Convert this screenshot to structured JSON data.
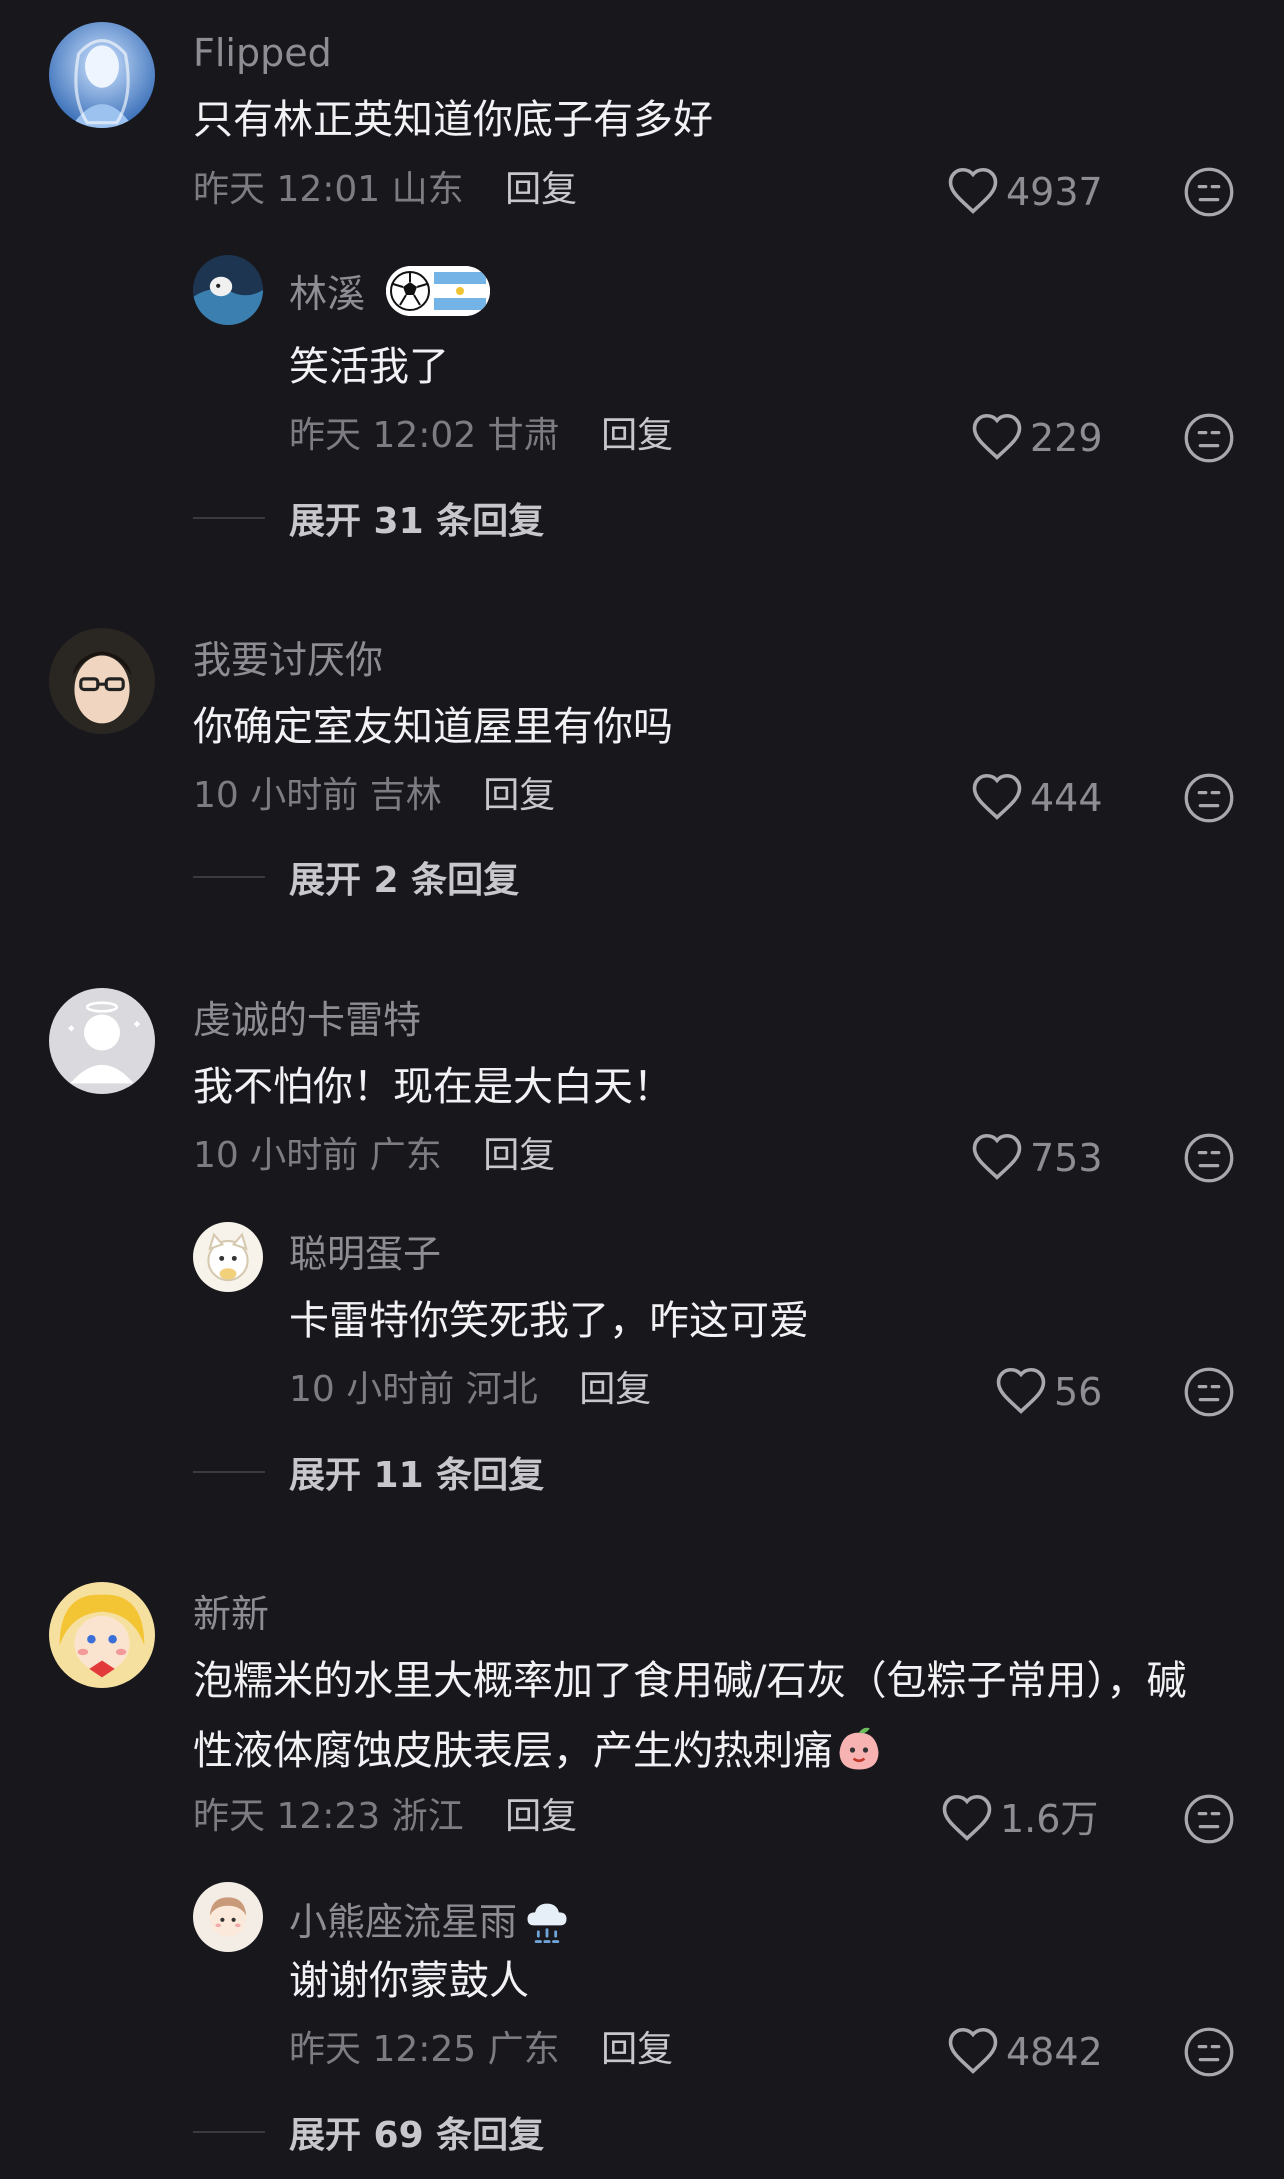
{
  "comments": [
    {
      "name": "Flipped",
      "text": "只有林正英知道你底子有多好",
      "time": "昨天 12:01",
      "location": "山东",
      "reply_label": "回复",
      "likes": "4937",
      "replies": [
        {
          "name": "林溪",
          "text": "笑活我了",
          "time": "昨天 12:02",
          "location": "甘肃",
          "reply_label": "回复",
          "likes": "229"
        }
      ],
      "expand_label": "展开 31 条回复"
    },
    {
      "name": "我要讨厌你",
      "text": "你确定室友知道屋里有你吗",
      "time": "10 小时前",
      "location": "吉林",
      "reply_label": "回复",
      "likes": "444",
      "expand_label": "展开 2 条回复"
    },
    {
      "name": "虔诚的卡雷特",
      "text": "我不怕你！现在是大白天！",
      "time": "10 小时前",
      "location": "广东",
      "reply_label": "回复",
      "likes": "753",
      "replies": [
        {
          "name": "聪明蛋子",
          "text": "卡雷特你笑死我了，咋这可爱",
          "time": "10 小时前",
          "location": "河北",
          "reply_label": "回复",
          "likes": "56"
        }
      ],
      "expand_label": "展开 11 条回复"
    },
    {
      "name": "新新",
      "text_line1": "泡糯米的水里大概率加了食用碱/石灰（包粽子常用），碱",
      "text_line2": "性液体腐蚀皮肤表层，产生灼热刺痛",
      "time": "昨天 12:23",
      "location": "浙江",
      "reply_label": "回复",
      "likes": "1.6万",
      "replies": [
        {
          "name": "小熊座流星雨",
          "text": "谢谢你蒙鼓人",
          "time": "昨天 12:25",
          "location": "广东",
          "reply_label": "回复",
          "likes": "4842"
        }
      ],
      "expand_label": "展开 69 条回复"
    }
  ],
  "icons": {
    "like": "heart-outline-icon",
    "reaction": "meh-face-icon",
    "badge": "football-argentina-badge",
    "snow": "snow-cloud-emoji",
    "peach": "peach-face-emoji"
  },
  "colors": {
    "background": "#17171c",
    "name": "#8d8d93",
    "text": "#f2f2f4",
    "meta": "#7c7c82"
  }
}
